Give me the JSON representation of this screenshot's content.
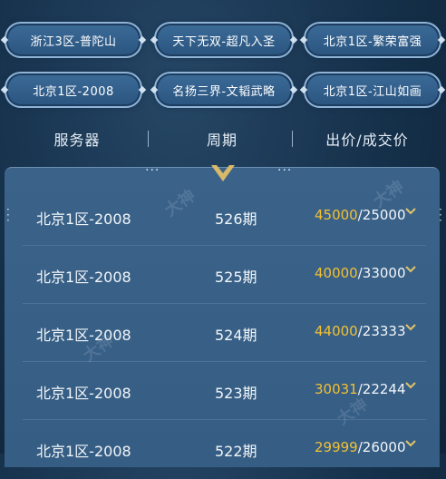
{
  "server_chips": [
    "浙江3区-普陀山",
    "天下无双-超凡入圣",
    "北京1区-繁荣富强",
    "北京1区-2008",
    "名扬三界-文韬武略",
    "北京1区-江山如画"
  ],
  "table_header": {
    "server": "服务器",
    "period": "周期",
    "price": "出价/成交价"
  },
  "rows": [
    {
      "server": "北京1区-2008",
      "period": "526期",
      "bid": "45000",
      "deal": "/25000"
    },
    {
      "server": "北京1区-2008",
      "period": "525期",
      "bid": "40000",
      "deal": "/33000"
    },
    {
      "server": "北京1区-2008",
      "period": "524期",
      "bid": "44000",
      "deal": "/23333"
    },
    {
      "server": "北京1区-2008",
      "period": "523期",
      "bid": "30031",
      "deal": "/22244"
    },
    {
      "server": "北京1区-2008",
      "period": "522期",
      "bid": "29999",
      "deal": "/26000"
    }
  ],
  "colors": {
    "bid": "#f2c033",
    "chip_bg": "#2f5c88",
    "panel": "#3a6288"
  },
  "watermark": "大神"
}
